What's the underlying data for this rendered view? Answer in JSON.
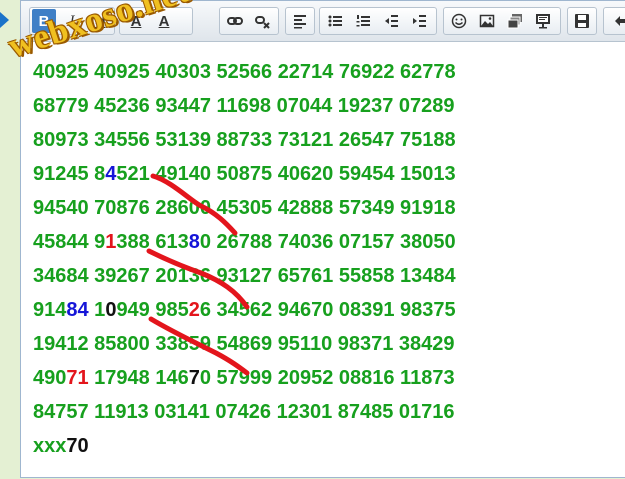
{
  "watermark": "webxoso.net",
  "toolbar": {
    "bold_label": "B",
    "italic_label": "I",
    "underline_label": "U",
    "font_color_label": "A",
    "bg_color_label": "A"
  },
  "lines": [
    [
      {
        "t": "40925 40925 40303 52566 22714 76922 62778"
      }
    ],
    [
      {
        "t": "68779 45236 93447 11698 07044 19237 07289"
      }
    ],
    [
      {
        "t": "80973 34556 53139 88733 73121 26547 75188"
      }
    ],
    [
      {
        "t": "91245 8"
      },
      {
        "t": "4",
        "c": "blue"
      },
      {
        "t": "521 49140 50875 40620 59454 15013"
      }
    ],
    [
      {
        "t": "94540 70876 28600 45305 42888 57349 91918"
      }
    ],
    [
      {
        "t": "45844 9"
      },
      {
        "t": "1",
        "c": "red"
      },
      {
        "t": "388 613"
      },
      {
        "t": "8",
        "c": "blue"
      },
      {
        "t": "0 26788 74036 07157 38050"
      }
    ],
    [
      {
        "t": "34684 39267 20136 93127 65761 55858 13484"
      }
    ],
    [
      {
        "t": "914"
      },
      {
        "t": "84",
        "c": "blue"
      },
      {
        "t": " 1"
      },
      {
        "t": "0",
        "c": "black"
      },
      {
        "t": "949 985"
      },
      {
        "t": "2",
        "c": "red"
      },
      {
        "t": "6 34562 94670 08391 98375"
      }
    ],
    [
      {
        "t": "19412 85800 33859 54869 95110 98371 38429"
      }
    ],
    [
      {
        "t": "490"
      },
      {
        "t": "71",
        "c": "red"
      },
      {
        "t": " 17948 146"
      },
      {
        "t": "7",
        "c": "black"
      },
      {
        "t": "0 57999 20952 08816 11873"
      }
    ],
    [
      {
        "t": "84757 11913 03141 07426 12301 87485 01716"
      }
    ],
    [
      {
        "t": "xxx"
      },
      {
        "t": "70",
        "c": "black"
      }
    ]
  ]
}
